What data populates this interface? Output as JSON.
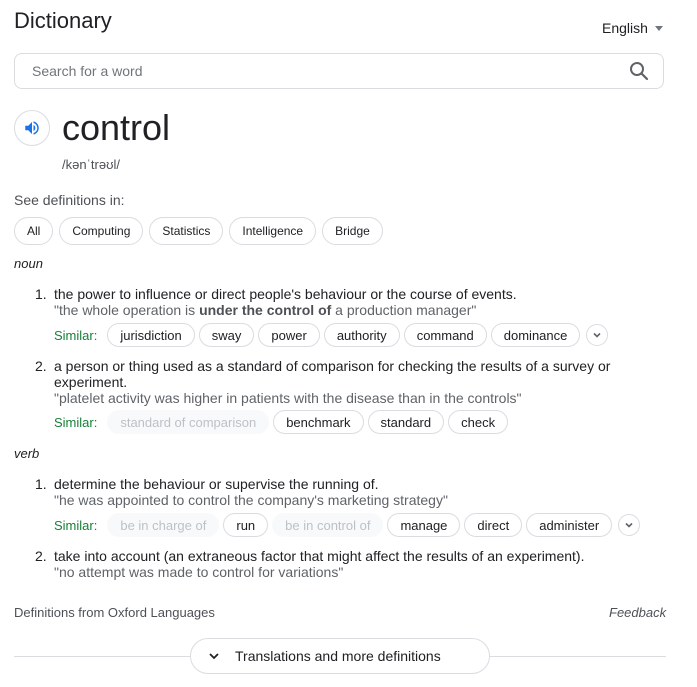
{
  "header": {
    "title": "Dictionary",
    "language": "English"
  },
  "search": {
    "placeholder": "Search for a word",
    "value": ""
  },
  "entry": {
    "word": "control",
    "phonetic": "/kənˈtrəʊl/",
    "see_definitions_label": "See definitions in:",
    "domains": [
      "All",
      "Computing",
      "Statistics",
      "Intelligence",
      "Bridge"
    ]
  },
  "noun": {
    "pos": "noun",
    "senses": [
      {
        "num": "1.",
        "definition": "the power to influence or direct people's behaviour or the course of events.",
        "example_pre": "\"the whole operation is ",
        "example_bold": "under the control of",
        "example_post": " a production manager\"",
        "similar_label": "Similar:",
        "similar": [
          "jurisdiction",
          "sway",
          "power",
          "authority",
          "command",
          "dominance"
        ]
      },
      {
        "num": "2.",
        "definition": "a person or thing used as a standard of comparison for checking the results of a survey or experiment.",
        "example": "\"platelet activity was higher in patients with the disease than in the controls\"",
        "similar_label": "Similar:",
        "similar_dim": "standard of comparison",
        "similar": [
          "benchmark",
          "standard",
          "check"
        ]
      }
    ]
  },
  "verb": {
    "pos": "verb",
    "senses": [
      {
        "num": "1.",
        "definition": "determine the behaviour or supervise the running of.",
        "example": "\"he was appointed to control the company's marketing strategy\"",
        "similar_label": "Similar:",
        "similar_dim1": "be in charge of",
        "similar_run": "run",
        "similar_dim2": "be in control of",
        "similar": [
          "manage",
          "direct",
          "administer"
        ]
      },
      {
        "num": "2.",
        "definition": "take into account (an extraneous factor that might affect the results of an experiment).",
        "example": "\"no attempt was made to control for variations\""
      }
    ]
  },
  "footer": {
    "source": "Definitions from Oxford Languages",
    "feedback": "Feedback",
    "more_button": "Translations and more definitions"
  },
  "colors": {
    "similar_label": "#188038",
    "speaker_icon": "#1a73e8",
    "border": "#dadce0"
  },
  "icons": [
    "search-icon",
    "speaker-icon",
    "chevron-down-icon",
    "caret-down-icon"
  ]
}
